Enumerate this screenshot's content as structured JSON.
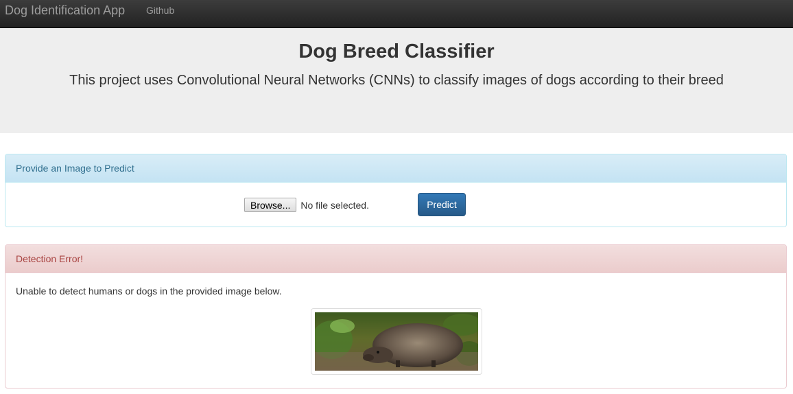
{
  "navbar": {
    "brand": "Dog Identification App",
    "links": [
      "Github"
    ],
    "colors": {
      "background": "#222222",
      "text": "#9d9d9d"
    }
  },
  "jumbotron": {
    "title": "Dog Breed Classifier",
    "subtitle": "This project uses Convolutional Neural Networks (CNNs) to classify images of dogs according to their breed"
  },
  "upload_panel": {
    "heading": "Provide an Image to Predict",
    "browse_label": "Browse...",
    "file_status": "No file selected.",
    "predict_label": "Predict",
    "colors": {
      "heading_text": "#31708f",
      "button": "#337ab7"
    }
  },
  "result_panel": {
    "heading": "Detection Error!",
    "message": "Unable to detect humans or dogs in the provided image below.",
    "image_subject": "hedgehog-photo",
    "colors": {
      "heading_text": "#a94442",
      "heading_bg": "#f2dede"
    }
  }
}
